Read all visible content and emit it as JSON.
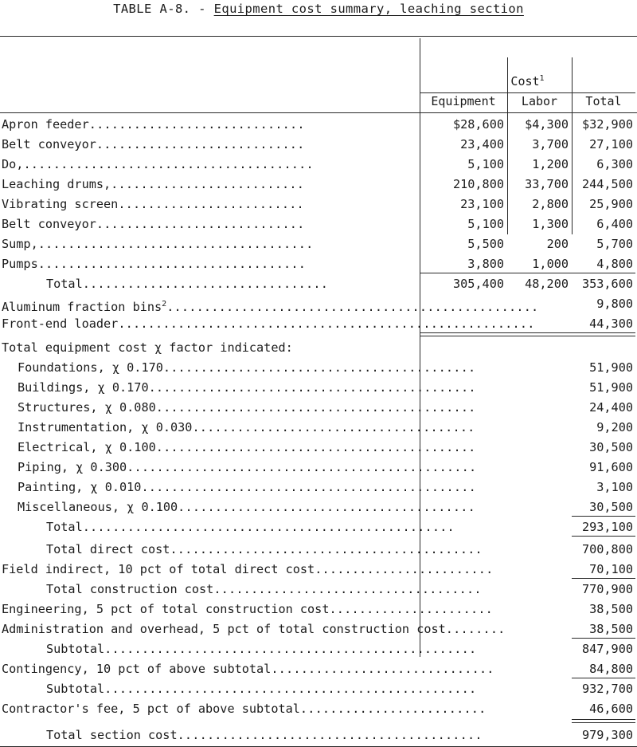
{
  "title": {
    "prefix": "TABLE A-8. - ",
    "underlined": "Equipment cost summary, leaching section"
  },
  "header": {
    "group_label": "Cost",
    "group_footnote": "1",
    "columns": [
      "Equipment",
      "Labor",
      "Total"
    ]
  },
  "section_note": "Total equipment cost χ factor indicated:",
  "leaders": {
    "d10": "..........",
    "d20": "....................",
    "d30": "..............................",
    "d40": "........................................"
  },
  "rows": [
    {
      "label": "Apron feeder",
      "dots": ".............................",
      "equipment": "$28,600",
      "labor": "$4,300",
      "total": "$32,900"
    },
    {
      "label": "Belt conveyor",
      "dots": "............................",
      "equipment": "23,400",
      "labor": "3,700",
      "total": "27,100"
    },
    {
      "label": "Do,",
      "dots": ".......................................",
      "equipment": "5,100",
      "labor": "1,200",
      "total": "6,300"
    },
    {
      "label": "Leaching drums,",
      "dots": "..........................",
      "equipment": "210,800",
      "labor": "33,700",
      "total": "244,500"
    },
    {
      "label": "Vibrating screen",
      "dots": ".........................",
      "equipment": "23,100",
      "labor": "2,800",
      "total": "25,900"
    },
    {
      "label": "Belt conveyor",
      "dots": "............................",
      "equipment": "5,100",
      "labor": "1,300",
      "total": "6,400"
    },
    {
      "label": "Sump,",
      "dots": ".....................................",
      "equipment": "5,500",
      "labor": "200",
      "total": "5,700"
    },
    {
      "label": "Pumps",
      "dots": "....................................",
      "equipment": "3,800",
      "labor": "1,000",
      "total": "4,800"
    },
    {
      "label": "Total",
      "dots": ".................................",
      "equipment": "305,400",
      "labor": "48,200",
      "total": "353,600",
      "indent": 1
    }
  ],
  "single_rows": [
    {
      "label": "Aluminum fraction bins",
      "footnote": "2",
      "dots": "..................................................",
      "total": "9,800",
      "indent": 0
    },
    {
      "label": "Front-end loader",
      "dots": "........................................................",
      "total": "44,300",
      "indent": 0
    }
  ],
  "factor_rows": [
    {
      "label": "Foundations, χ 0.170",
      "dots": "..........................................",
      "total": "51,900"
    },
    {
      "label": "Buildings, χ 0.170",
      "dots": "............................................",
      "total": "51,900"
    },
    {
      "label": "Structures, χ 0.080",
      "dots": "...........................................",
      "total": "24,400"
    },
    {
      "label": "Instrumentation, χ 0.030",
      "dots": "......................................",
      "total": "9,200"
    },
    {
      "label": "Electrical, χ 0.100",
      "dots": "...........................................",
      "total": "30,500"
    },
    {
      "label": "Piping, χ 0.300",
      "dots": "...............................................",
      "total": "91,600"
    },
    {
      "label": "Painting, χ 0.010",
      "dots": ".............................................",
      "total": "3,100"
    },
    {
      "label": "Miscellaneous, χ 0.100",
      "dots": "........................................",
      "total": "30,500"
    }
  ],
  "factor_total": {
    "label": "Total",
    "dots": "..................................................",
    "total": "293,100"
  },
  "summary_rows": [
    {
      "label": "Total direct cost",
      "dots": "..........................................",
      "total": "700,800",
      "indent": 2
    },
    {
      "label": "Field indirect, 10 pct of total direct cost",
      "dots": "........................",
      "total": "70,100",
      "indent": 0
    },
    {
      "label": "Total construction cost",
      "dots": "....................................",
      "total": "770,900",
      "indent": 2
    },
    {
      "label": "Engineering, 5 pct of total construction cost",
      "dots": "......................",
      "total": "38,500",
      "indent": 0
    },
    {
      "label": "Administration and overhead, 5 pct of total construction cost",
      "dots": "........",
      "total": "38,500",
      "indent": 0
    },
    {
      "label": "Subtotal",
      "dots": "..................................................",
      "total": "847,900",
      "indent": 2
    },
    {
      "label": "Contingency, 10 pct of above subtotal",
      "dots": "..............................",
      "total": "84,800",
      "indent": 0
    },
    {
      "label": "Subtotal",
      "dots": "..................................................",
      "total": "932,700",
      "indent": 2
    },
    {
      "label": "Contractor's fee, 5 pct of above subtotal",
      "dots": ".........................",
      "total": "46,600",
      "indent": 0
    }
  ],
  "grand_total": {
    "label": "Total section cost",
    "dots": ".........................................",
    "total": "979,300"
  }
}
